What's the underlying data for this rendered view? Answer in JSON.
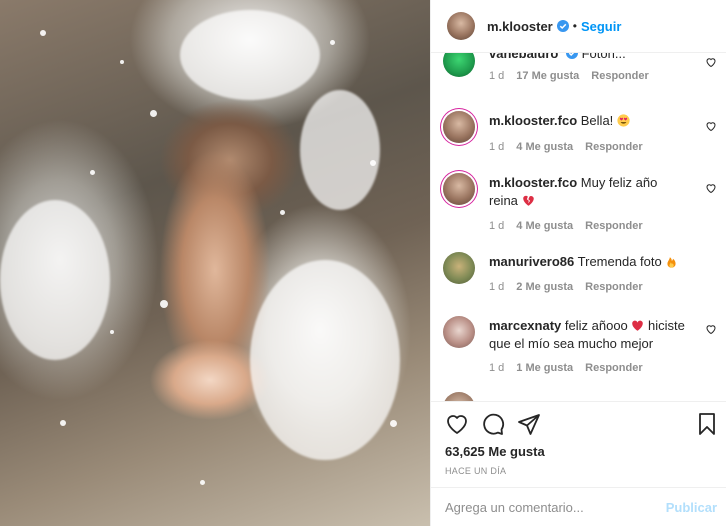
{
  "post": {
    "author": "m.klooster",
    "follow_label": "Seguir",
    "dot": "•",
    "likes": "63,625 Me gusta",
    "time": "HACE UN DÍA"
  },
  "comments": [
    {
      "user": "vanebaluro",
      "text": "Fotón...",
      "age": "1 d",
      "likes": "17 Me gusta",
      "reply": "Responder"
    },
    {
      "user": "m.klooster.fco",
      "text": "Bella!",
      "age": "1 d",
      "likes": "4 Me gusta",
      "reply": "Responder"
    },
    {
      "user": "m.klooster.fco",
      "text": "Muy feliz año reina",
      "age": "1 d",
      "likes": "4 Me gusta",
      "reply": "Responder"
    },
    {
      "user": "manurivero86",
      "text": "Tremenda foto",
      "age": "1 d",
      "likes": "2 Me gusta",
      "reply": "Responder"
    },
    {
      "user": "marcexnaty",
      "text": "feliz añooo",
      "text2": "hiciste que el mío sea mucho mejor",
      "age": "1 d",
      "likes": "1 Me gusta",
      "reply": "Responder"
    }
  ],
  "composer": {
    "placeholder": "Agrega un comentario...",
    "publish_label": "Publicar"
  },
  "colors": {
    "accent": "#0095f6",
    "publish_disabled": "#b2dffc",
    "muted": "#8e8e8e",
    "verified": "#3897f0"
  },
  "icons": [
    "verified-badge-icon",
    "heart-icon",
    "comment-icon",
    "share-icon",
    "bookmark-icon",
    "emoji-icon"
  ]
}
